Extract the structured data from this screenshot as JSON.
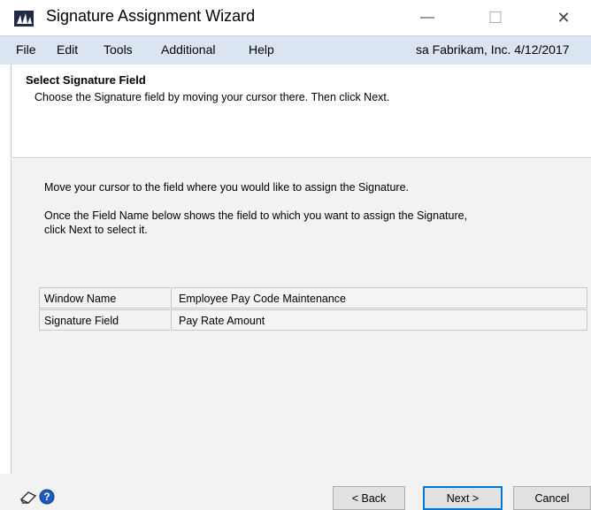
{
  "window": {
    "title": "Signature Assignment Wizard",
    "minimize_glyph": "—",
    "maximize_glyph": "☐",
    "close_glyph": "✕"
  },
  "menu": {
    "items": [
      "File",
      "Edit",
      "Tools",
      "Additional",
      "Help"
    ],
    "status": "sa  Fabrikam, Inc.  4/12/2017"
  },
  "header": {
    "title": "Select Signature Field",
    "subtitle": "Choose the Signature field by moving your cursor there. Then click Next."
  },
  "body": {
    "instruction1": "Move your cursor to the field where you would like to assign the Signature.",
    "instruction2_line1": "Once the Field Name below shows the field to which you want to assign the Signature,",
    "instruction2_line2": "click Next to select it."
  },
  "fields": [
    {
      "label": "Window Name",
      "value": "Employee Pay Code Maintenance"
    },
    {
      "label": "Signature Field",
      "value": "Pay Rate Amount"
    }
  ],
  "buttons": {
    "back": "< Back",
    "next": "Next >",
    "cancel": "Cancel"
  },
  "icons": {
    "app": "dynamics-logo-icon",
    "note": "note-icon",
    "help": "help-icon"
  }
}
